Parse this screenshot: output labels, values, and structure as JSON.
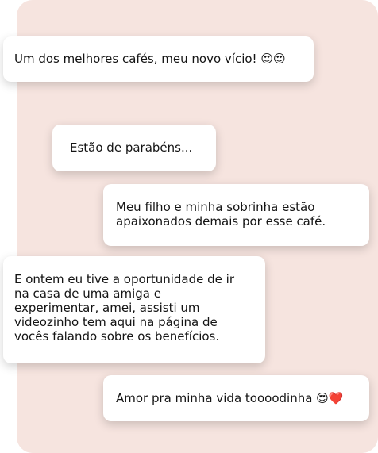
{
  "messages": [
    {
      "text": "Um dos melhores cafés, meu novo vício! 😍😍"
    },
    {
      "text": "Estão de parabéns..."
    },
    {
      "text": "Meu filho e minha sobrinha estão\napaixonados demais por esse café."
    },
    {
      "text": "E ontem eu tive a oportunidade de ir\nna casa de uma amiga e\nexperimentar, amei, assisti um\nvideozinho tem aqui na página de\nvocês falando sobre os benefícios."
    },
    {
      "text": "Amor pra minha vida toooodinha 😍❤️"
    }
  ]
}
